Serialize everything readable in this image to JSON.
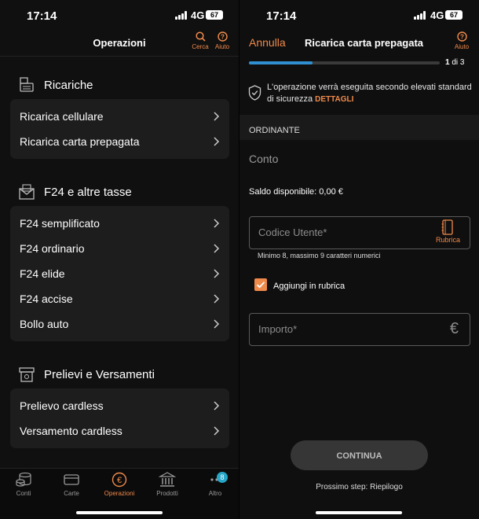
{
  "status": {
    "time": "17:14",
    "network": "4G",
    "battery": "67"
  },
  "left": {
    "header": {
      "title": "Operazioni",
      "search_label": "Cerca",
      "help_label": "Aiuto"
    },
    "sections": [
      {
        "title": "Ricariche",
        "icon": "printer-icon",
        "items": [
          "Ricarica cellulare",
          "Ricarica carta prepagata"
        ]
      },
      {
        "title": "F24 e altre tasse",
        "icon": "envelope-icon",
        "items": [
          "F24 semplificato",
          "F24 ordinario",
          "F24 elide",
          "F24 accise",
          "Bollo auto"
        ]
      },
      {
        "title": "Prelievi e Versamenti",
        "icon": "atm-icon",
        "items": [
          "Prelievo cardless",
          "Versamento cardless"
        ]
      }
    ],
    "tabs": [
      {
        "label": "Conti",
        "icon": "coins-icon",
        "active": false
      },
      {
        "label": "Carte",
        "icon": "card-icon",
        "active": false
      },
      {
        "label": "Operazioni",
        "icon": "euro-icon",
        "active": true
      },
      {
        "label": "Prodotti",
        "icon": "bank-icon",
        "active": false
      },
      {
        "label": "Altro",
        "icon": "more-icon",
        "active": false,
        "badge": "8"
      }
    ]
  },
  "right": {
    "cancel_label": "Annulla",
    "title": "Ricarica carta prepagata",
    "help_label": "Aiuto",
    "progress": {
      "current": "1",
      "of_text": "di 3",
      "fraction": 0.333
    },
    "security_text": "L'operazione verrà eseguita secondo elevati standard di sicurezza",
    "security_link": "DETTAGLI",
    "section_label": "ORDINANTE",
    "account_placeholder": "Conto",
    "balance_text": "Saldo disponibile: 0,00 €",
    "user_code_placeholder": "Codice Utente*",
    "rubrica_label": "Rubrica",
    "user_code_hint": "Minimo 8, massimo 9 caratteri numerici",
    "add_to_rubrica_label": "Aggiungi in rubrica",
    "add_to_rubrica_checked": true,
    "amount_placeholder": "Importo*",
    "currency_symbol": "€",
    "continue_label": "CONTINUA",
    "next_step_text": "Prossimo step: Riepilogo"
  },
  "colors": {
    "accent": "#f08a4b",
    "progress": "#2f8fd1",
    "badge": "#27a7c8",
    "card": "#1d1d1d"
  }
}
